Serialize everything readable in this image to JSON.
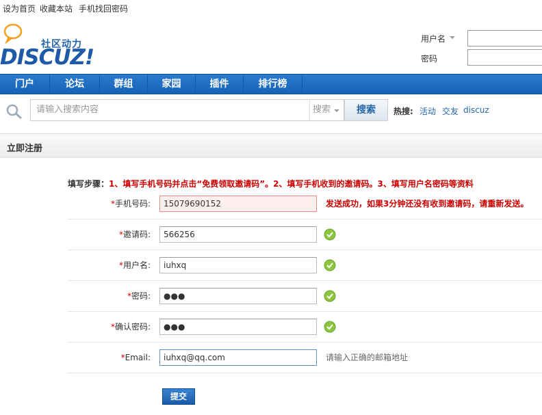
{
  "topbar": {
    "set_home": "设为首页",
    "bookmark": "收藏本站",
    "phone_recover": "手机找回密码"
  },
  "logo": {
    "tagline": "社区动力",
    "wordmark": "DISCUZ!"
  },
  "login": {
    "username_label": "用户名",
    "password_label": "密码"
  },
  "nav": {
    "items": [
      "门户",
      "论坛",
      "群组",
      "家园",
      "插件",
      "排行榜"
    ]
  },
  "search": {
    "placeholder": "请输入搜索内容",
    "type": "搜索",
    "button": "搜索",
    "hot_label": "热搜:",
    "hot_links": [
      "活动",
      "交友",
      "discuz"
    ]
  },
  "section": {
    "title": "立即注册"
  },
  "steps": {
    "label": "填写步骤：",
    "text": "1、填写手机号码并点击“免费领取邀请码”。2、填写手机收到的邀请码。3、填写用户名密码等资料"
  },
  "form": {
    "phone": {
      "req": "*",
      "label": "手机号码:",
      "value": "15079690152",
      "tip": "发送成功，如果3分钟还没有收到邀请码，请重新发送。"
    },
    "invite": {
      "req": "*",
      "label": "邀请码:",
      "value": "566256"
    },
    "username": {
      "req": "*",
      "label": "用户名:",
      "value": "iuhxq"
    },
    "password": {
      "req": "*",
      "label": "密码:",
      "value": "●●●"
    },
    "confirm": {
      "req": "*",
      "label": "确认密码:",
      "value": "●●●"
    },
    "email": {
      "req": "*",
      "label": "Email:",
      "value": "iuhxq@qq.com",
      "tip": "请输入正确的邮箱地址"
    }
  },
  "submit": {
    "label": "提交"
  },
  "colors": {
    "nav_blue": "#1f6dbf",
    "link_blue": "#2366A8",
    "error_red": "#cc0000",
    "check_green": "#8cc63f"
  }
}
